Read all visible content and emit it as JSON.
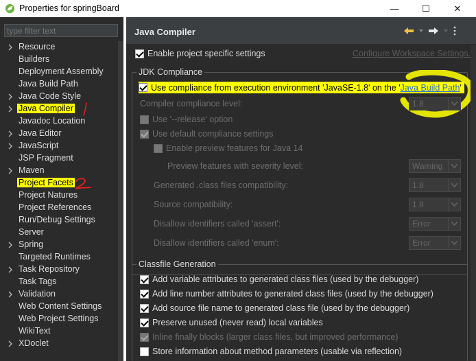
{
  "window": {
    "title": "Properties for springBoard",
    "minimize": "—",
    "maximize": "☐",
    "close": "✕"
  },
  "filter": {
    "placeholder": "type filter text"
  },
  "tree": [
    {
      "label": "Resource",
      "expandable": true
    },
    {
      "label": "Builders",
      "expandable": false
    },
    {
      "label": "Deployment Assembly",
      "expandable": false
    },
    {
      "label": "Java Build Path",
      "expandable": false
    },
    {
      "label": "Java Code Style",
      "expandable": true
    },
    {
      "label": "Java Compiler",
      "expandable": true,
      "highlighted": true
    },
    {
      "label": "Javadoc Location",
      "expandable": false
    },
    {
      "label": "Java Editor",
      "expandable": true
    },
    {
      "label": "JavaScript",
      "expandable": true
    },
    {
      "label": "JSP Fragment",
      "expandable": false
    },
    {
      "label": "Maven",
      "expandable": true
    },
    {
      "label": "Project Facets",
      "expandable": false,
      "highlighted": true
    },
    {
      "label": "Project Natures",
      "expandable": false
    },
    {
      "label": "Project References",
      "expandable": false
    },
    {
      "label": "Run/Debug Settings",
      "expandable": false
    },
    {
      "label": "Server",
      "expandable": false
    },
    {
      "label": "Spring",
      "expandable": true
    },
    {
      "label": "Targeted Runtimes",
      "expandable": false
    },
    {
      "label": "Task Repository",
      "expandable": true
    },
    {
      "label": "Task Tags",
      "expandable": false
    },
    {
      "label": "Validation",
      "expandable": true
    },
    {
      "label": "Web Content Settings",
      "expandable": false
    },
    {
      "label": "Web Project Settings",
      "expandable": false
    },
    {
      "label": "WikiText",
      "expandable": false
    },
    {
      "label": "XDoclet",
      "expandable": true
    }
  ],
  "annotations": {
    "mark1": "1",
    "mark2": "2"
  },
  "page": {
    "title": "Java Compiler",
    "enable_specific": "Enable project specific settings",
    "configure_workspace": "Configure Workspace Settings...",
    "jdk_group": "JDK Compliance",
    "use_compliance_prefix": "Use compliance from execution environment 'JavaSE-1.8' on the '",
    "use_compliance_link": "Java Build Path",
    "use_compliance_suffix": "'",
    "compliance_level": "Compiler compliance level:",
    "compliance_level_value": "1.8",
    "use_release": "Use '--release' option",
    "use_default": "Use default compliance settings",
    "enable_preview": "Enable preview features for Java 14",
    "preview_severity": "Preview features with severity level:",
    "preview_severity_value": "Warning",
    "generated_class": "Generated .class files compatibility:",
    "generated_class_value": "1.8",
    "source_compat": "Source compatibility:",
    "source_compat_value": "1.8",
    "disallow_assert": "Disallow identifiers called 'assert':",
    "disallow_assert_value": "Error",
    "disallow_enum": "Disallow identifiers called 'enum':",
    "disallow_enum_value": "Error",
    "classfile_group": "Classfile Generation",
    "classfile_items": [
      {
        "label": "Add variable attributes to generated class files (used by the debugger)",
        "checked": true,
        "disabled": false
      },
      {
        "label": "Add line number attributes to generated class files (used by the debugger)",
        "checked": true,
        "disabled": false
      },
      {
        "label": "Add source file name to generated class file (used by the debugger)",
        "checked": true,
        "disabled": false
      },
      {
        "label": "Preserve unused (never read) local variables",
        "checked": true,
        "disabled": false
      },
      {
        "label": "Inline finally blocks (larger class files, but improved performance)",
        "checked": true,
        "disabled": true
      },
      {
        "label": "Store information about method parameters (usable via reflection)",
        "checked": false,
        "disabled": false
      }
    ]
  },
  "colors": {
    "highlight": "#ffff00",
    "annotation_red": "#e02020",
    "link": "#2a6fd6"
  }
}
